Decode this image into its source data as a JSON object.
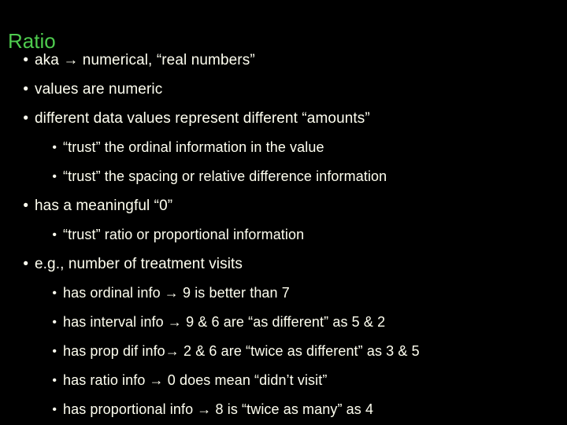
{
  "slide": {
    "background_color": "#000000",
    "title": "Ratio",
    "title_color": "#4ecb4e",
    "body_color": "#fffff0",
    "bullet_glyph": "•",
    "bullets": [
      {
        "level": 1,
        "text": "aka →  numerical, “real numbers”"
      },
      {
        "level": 1,
        "text": "values are numeric"
      },
      {
        "level": 1,
        "text": "different data values represent different “amounts”"
      },
      {
        "level": 2,
        "text": "“trust” the ordinal information in the value"
      },
      {
        "level": 2,
        "text": "“trust” the spacing or relative difference information"
      },
      {
        "level": 1,
        "text": "has a meaningful “0”"
      },
      {
        "level": 2,
        "text": "“trust” ratio or proportional information"
      },
      {
        "level": 1,
        "text": "e.g., number of treatment visits"
      },
      {
        "level": 2,
        "text": "has ordinal info → 9  is better than 7"
      },
      {
        "level": 2,
        "text": "has interval info → 9 & 6 are “as different” as 5 & 2"
      },
      {
        "level": 2,
        "text": "has prop dif info→ 2 & 6 are “twice as different” as 3 & 5"
      },
      {
        "level": 2,
        "text": "has ratio info → 0 does mean “didn’t visit”"
      },
      {
        "level": 2,
        "text": "has proportional info →  8 is “twice as many” as 4"
      }
    ]
  }
}
